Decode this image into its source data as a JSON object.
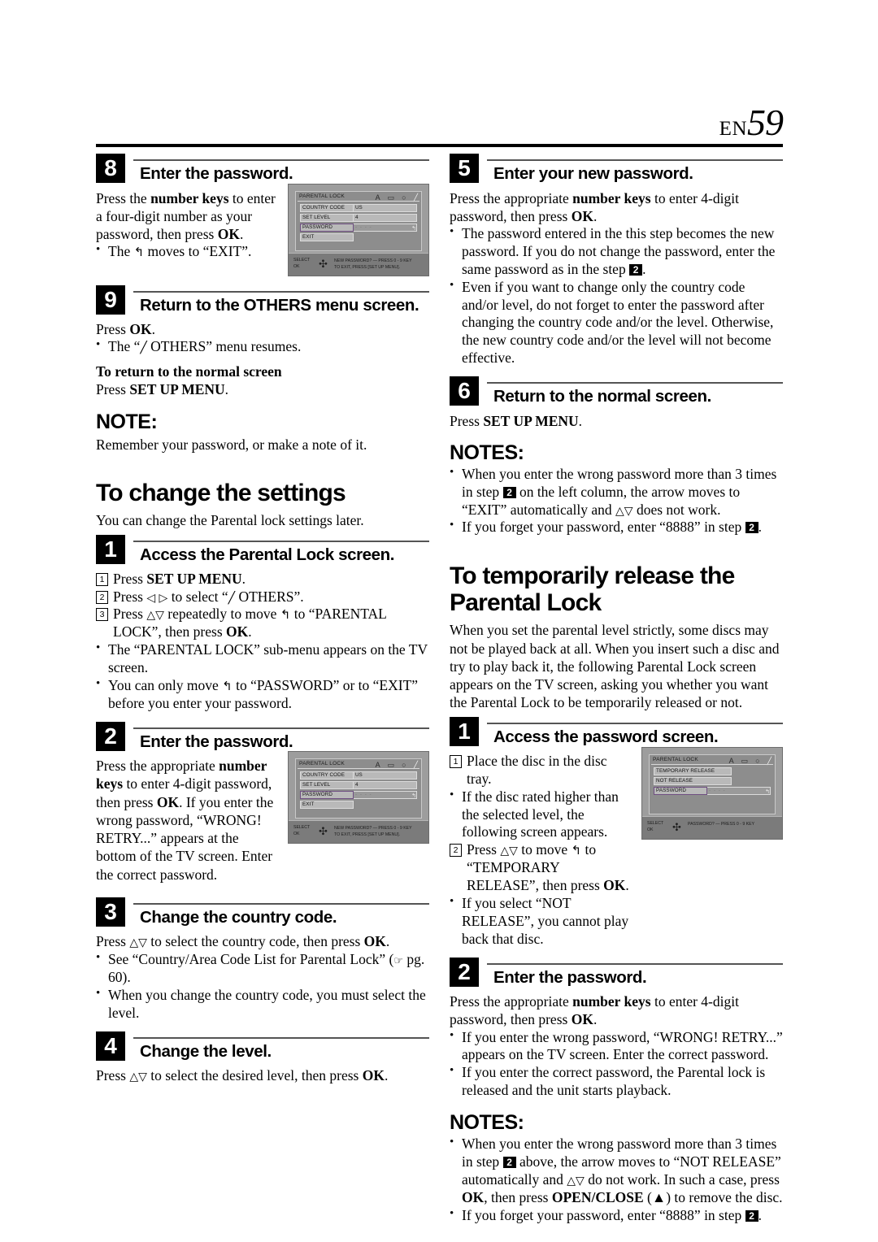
{
  "header": {
    "en_label": "EN",
    "page_number": "59"
  },
  "left_column": {
    "step8": {
      "number": "8",
      "title": "Enter the password.",
      "paragraph_1": "Press the ",
      "paragraph_1_bold": "number keys",
      "paragraph_1_rest": " to enter a four-digit number as your password, then press ",
      "paragraph_1_bold2": "OK",
      "paragraph_1_end": ".",
      "bullet_1_pre": "The ",
      "bullet_1_post": " moves to “EXIT”."
    },
    "step9": {
      "number": "9",
      "title": "Return to the OTHERS menu screen.",
      "press_label": "Press ",
      "press_bold": "OK",
      "press_end": ".",
      "bullet_1": "The “",
      "bullet_1_end": " OTHERS” menu resumes.",
      "return_head": "To return to the normal screen",
      "return_press": "Press ",
      "return_bold": "SET UP MENU",
      "return_end": ".",
      "note_title": "NOTE:",
      "note_text": "Remember your password, or make a note of it."
    },
    "section": {
      "title": "To change the settings",
      "intro": "You can change the Parental lock settings later."
    },
    "step1": {
      "number": "1",
      "title": "Access the Parental Lock screen.",
      "item_1_pre": "Press ",
      "item_1_bold": "SET UP MENU",
      "item_1_end": ".",
      "item_2_pre": "Press ",
      "item_2_mid": " to select “",
      "item_2_end": " OTHERS”.",
      "item_3_pre": "Press ",
      "item_3_mid": " repeatedly to move ",
      "item_3_mid2": " to “PARENTAL LOCK”, then press ",
      "item_3_bold": "OK",
      "item_3_end": ".",
      "bullet_1": "The “PARENTAL LOCK” sub-menu appears on the TV screen.",
      "bullet_2_pre": "You can only move ",
      "bullet_2_post": " to “PASSWORD” or to “EXIT” before you enter your password."
    },
    "step2": {
      "number": "2",
      "title": "Enter the password.",
      "para_pre": "Press the appropriate ",
      "para_bold": "number keys",
      "para_mid": " to enter 4-digit password, then press ",
      "para_bold2": "OK",
      "para_rest": ". If you enter the wrong password, “WRONG! RETRY...” appears at the bottom of the TV screen. Enter the correct password."
    },
    "step3": {
      "number": "3",
      "title": "Change the country code.",
      "para_pre": "Press ",
      "para_mid": " to select the country code, then press ",
      "para_bold": "OK",
      "para_end": ".",
      "bullet_1": "See “Country/Area Code List for Parental Lock” (",
      "bullet_1_end": " pg. 60).",
      "bullet_2": "When you change the country code, you must select the level."
    },
    "step4": {
      "number": "4",
      "title": "Change the level.",
      "para_pre": "Press ",
      "para_mid": " to select the desired level, then press ",
      "para_bold": "OK",
      "para_end": "."
    }
  },
  "right_column": {
    "step5": {
      "number": "5",
      "title": "Enter your new password.",
      "para_pre": "Press the appropriate ",
      "para_bold": "number keys",
      "para_mid": " to enter 4-digit password, then press ",
      "para_bold2": "OK",
      "para_end": ".",
      "bullet_1_a": "The password entered in the this step becomes the new password. If you do not change the password, enter the same password as in the step ",
      "bullet_1_step": "2",
      "bullet_1_b": ".",
      "bullet_2": "Even if you want to change only the country code and/or level, do not forget to enter the password after changing the country code and/or the level. Otherwise, the new country code and/or the level will not become effective."
    },
    "step6": {
      "number": "6",
      "title": "Return to the normal screen.",
      "para_pre": "Press ",
      "para_bold": "SET UP MENU",
      "para_end": ".",
      "notes_title": "NOTES:",
      "note_1_a": "When you enter the wrong password more than 3 times in step ",
      "note_1_step": "2",
      "note_1_b": " on the left column, the arrow moves to “EXIT” automatically and ",
      "note_1_c": " does not work.",
      "note_2_a": "If you forget your password, enter “8888” in step ",
      "note_2_step": "2",
      "note_2_b": "."
    },
    "section": {
      "title": "To temporarily release the Parental Lock",
      "intro": "When you set the parental level strictly, some discs may not be played back at all. When you insert such a disc and try to play back it, the following Parental Lock screen appears on the TV screen, asking you whether you want the Parental Lock to be temporarily released or not."
    },
    "step1": {
      "number": "1",
      "title": "Access the password screen.",
      "item_1": "Place the disc in the disc tray.",
      "bullet_1": "If the disc rated higher than the selected level, the following screen appears.",
      "item_2_pre": "Press ",
      "item_2_mid": " to move ",
      "item_2_post": " to “TEMPORARY RELEASE”, then press ",
      "item_2_bold": "OK",
      "item_2_end": ".",
      "bullet_2": "If you select “NOT RELEASE”, you cannot play back that disc."
    },
    "step2": {
      "number": "2",
      "title": "Enter the password.",
      "para_pre": "Press the appropriate ",
      "para_bold": "number keys",
      "para_mid": " to enter 4-digit password, then press ",
      "para_bold2": "OK",
      "para_end": ".",
      "bullet_1": "If you enter the wrong password, “WRONG! RETRY...” appears on the TV screen. Enter the correct password.",
      "bullet_2": "If you enter the correct password, the Parental lock is released and the unit starts playback.",
      "notes_title": "NOTES:",
      "note_1_a": "When you enter the wrong password more than 3 times in step ",
      "note_1_step": "2",
      "note_1_b": " above, the arrow moves to “NOT RELEASE” automatically and ",
      "note_1_c": " do not work. In such a case, press ",
      "note_1_bold_ok": "OK",
      "note_1_d": ", then press ",
      "note_1_bold_oc": "OPEN/CLOSE",
      "note_1_e": " (",
      "note_1_f": ") to remove the disc.",
      "note_2_a": "If you forget your password, enter “8888” in step ",
      "note_2_step": "2",
      "note_2_b": "."
    }
  },
  "tv_screen_parental": {
    "title": "PARENTAL LOCK",
    "tabs": [
      "A",
      "▭",
      "○",
      "╱"
    ],
    "rows": [
      {
        "label": "COUNTRY CODE",
        "value": "US"
      },
      {
        "label": "SET LEVEL",
        "value": "4"
      },
      {
        "label": "PASSWORD",
        "value": "- - - -"
      },
      {
        "label": "EXIT",
        "value": ""
      }
    ],
    "bottom_left_line1": "SELECT",
    "bottom_left_line2": "OK",
    "bottom_right_line1": "NEW PASSWORD? — PRESS 0 - 9 KEY",
    "bottom_right_line2": "TO EXIT, PRESS [SET UP MENU]."
  },
  "tv_screen_release": {
    "title": "PARENTAL LOCK",
    "tabs": [
      "A",
      "▭",
      "○",
      "╱"
    ],
    "rows": [
      {
        "label": "TEMPORARY RELEASE",
        "value": ""
      },
      {
        "label": "NOT RELEASE",
        "value": ""
      },
      {
        "label": "PASSWORD",
        "value": "- - - -"
      }
    ],
    "bottom_left_line1": "SELECT",
    "bottom_left_line2": "OK",
    "bottom_right_line1": "PASSWORD? — PRESS 0 - 9 KEY",
    "bottom_right_line2": ""
  },
  "glyphs": {
    "cursor_arrow": "↰",
    "left_right": "◁ ▷",
    "up_down": "△▽",
    "wrench": "╱",
    "hand_pointer": "☞",
    "eject": "▲"
  }
}
